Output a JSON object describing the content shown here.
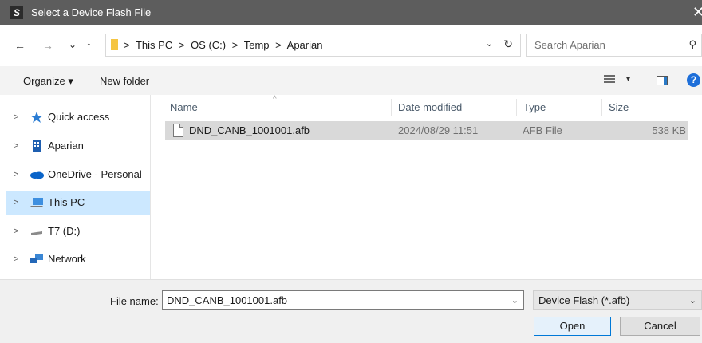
{
  "window": {
    "title": "Select a Device Flash File",
    "app_icon_letter": "S",
    "close_glyph": "✕"
  },
  "navigation": {
    "back": "←",
    "forward": "→",
    "recent": "⌄",
    "up": "↑"
  },
  "address": {
    "crumbs": [
      ">",
      "This PC",
      ">",
      "OS (C:)",
      ">",
      "Temp",
      ">",
      "Aparian"
    ],
    "dropdown_glyph": "⌄",
    "refresh_glyph": "↻"
  },
  "search": {
    "placeholder": "Search Aparian",
    "icon": "search-icon"
  },
  "toolbar": {
    "organize": "Organize ▾",
    "new_folder": "New folder",
    "views_drop": "▾",
    "help": "?"
  },
  "sidebar": {
    "items": [
      {
        "label": "Quick access",
        "icon": "star-icon",
        "selected": false
      },
      {
        "label": "Aparian",
        "icon": "building-icon",
        "selected": false
      },
      {
        "label": "OneDrive - Personal",
        "icon": "cloud-icon",
        "selected": false
      },
      {
        "label": "This PC",
        "icon": "computer-icon",
        "selected": true
      },
      {
        "label": "T7 (D:)",
        "icon": "drive-icon",
        "selected": false
      },
      {
        "label": "Network",
        "icon": "network-icon",
        "selected": false
      }
    ],
    "chevron": ">"
  },
  "file_list": {
    "sort_indicator": "^",
    "columns": [
      "Name",
      "Date modified",
      "Type",
      "Size"
    ],
    "rows": [
      {
        "name": "DND_CANB_1001001.afb",
        "date": "2024/08/29 11:51",
        "type": "AFB File",
        "size": "538 KB",
        "selected": true
      }
    ]
  },
  "footer": {
    "file_name_label": "File name:",
    "file_name_value": "DND_CANB_1001001.afb",
    "dropdown_glyph": "⌄",
    "file_type": "Device Flash (*.afb)",
    "open_label": "Open",
    "cancel_label": "Cancel"
  },
  "colors": {
    "titlebar": "#5d5d5d",
    "selection": "#cce8ff",
    "row_selected": "#d9d9d9",
    "accent": "#0078d7"
  }
}
